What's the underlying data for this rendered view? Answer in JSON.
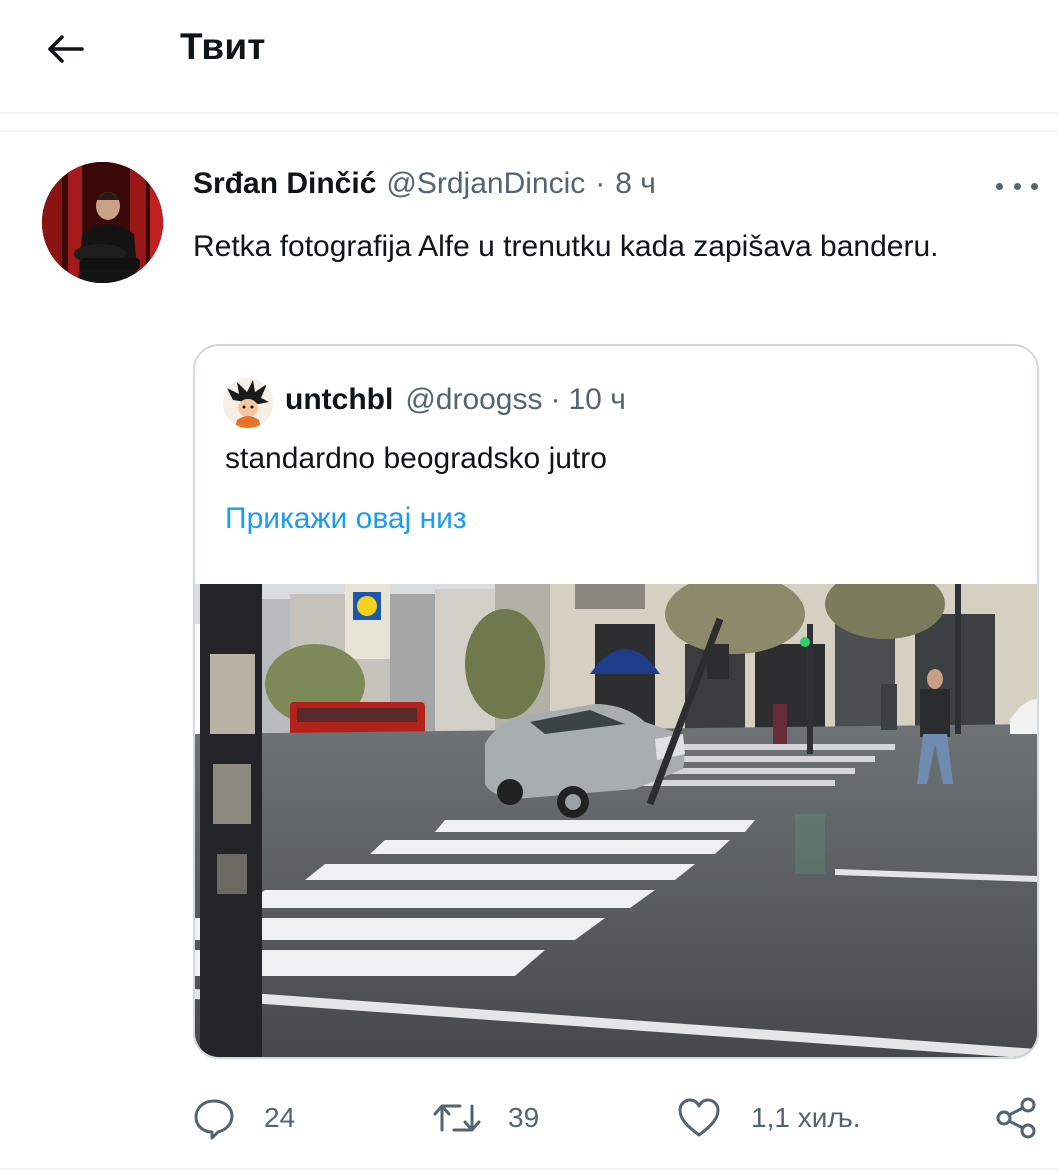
{
  "header": {
    "back_icon": "arrow-left-icon",
    "title": "Твит"
  },
  "tweet": {
    "author_name": "Srđan Dinčić",
    "author_handle": "@SrdjanDincic",
    "separator": "·",
    "time": "8 ч",
    "more_icon": "more-horizontal-icon",
    "text": "Retka fotografija Alfe u trenutku kada zapišava banderu."
  },
  "quote": {
    "author_name": "untchbl",
    "author_handle": "@droogss",
    "separator": "·",
    "time": "10 ч",
    "text": "standardno beogradsko jutro",
    "show_thread": "Прикажи овај низ"
  },
  "actions": {
    "reply_icon": "reply-icon",
    "reply_count": "24",
    "retweet_icon": "retweet-icon",
    "retweet_count": "39",
    "like_icon": "heart-icon",
    "like_count": "1,1 хиљ.",
    "share_icon": "share-icon"
  },
  "colors": {
    "text": "#0f1419",
    "secondary": "#536471",
    "link": "#1d9bf0",
    "border": "#cfd9de",
    "divider": "#eff3f4"
  }
}
